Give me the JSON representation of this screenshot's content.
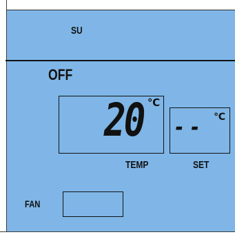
{
  "display": {
    "mode": "SU",
    "status": "OFF",
    "temp": {
      "value": "20",
      "unit": "℃",
      "label": "TEMP"
    },
    "set": {
      "value": "--",
      "unit": "℃",
      "label": "SET"
    },
    "fan": {
      "label": "FAN",
      "value": ""
    }
  },
  "colors": {
    "lcd_background": "#7fb6e7",
    "segment": "#111111"
  }
}
